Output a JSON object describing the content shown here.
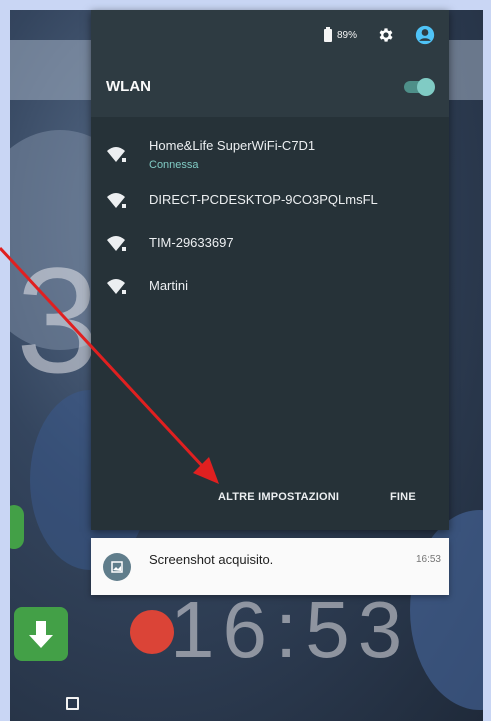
{
  "status": {
    "battery_text": "89%"
  },
  "panel": {
    "title": "WLAN",
    "toggle_on": true,
    "networks": [
      {
        "name": "Home&Life SuperWiFi-C7D1",
        "status": "Connessa"
      },
      {
        "name": "DIRECT-PCDESKTOP-9CO3PQLmsFL",
        "status": ""
      },
      {
        "name": "TIM-29633697",
        "status": ""
      },
      {
        "name": "Martini",
        "status": ""
      }
    ],
    "more_settings_label": "ALTRE IMPOSTAZIONI",
    "done_label": "FINE"
  },
  "notification": {
    "title": "Screenshot acquisito.",
    "time": "16:53"
  },
  "background": {
    "digit": "3",
    "clock": "16:53"
  },
  "colors": {
    "accent": "#80cbc4",
    "panel_bg": "#263238",
    "annotation_arrow": "#e02020"
  },
  "icons": {
    "battery": "battery-icon",
    "settings": "gear-icon",
    "account": "user-account-icon",
    "wifi": "wifi-locked-icon",
    "notification": "image-icon",
    "recents": "square-nav-icon"
  }
}
